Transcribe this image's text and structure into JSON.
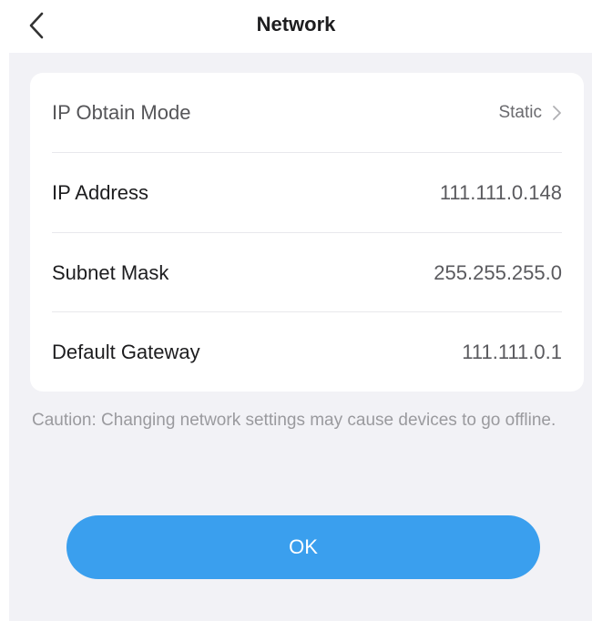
{
  "header": {
    "title": "Network",
    "back_icon": "chevron-left-icon"
  },
  "settings": {
    "rows": [
      {
        "label": "IP Obtain Mode",
        "value": "Static"
      },
      {
        "label": "IP Address",
        "value": "111.111.0.148"
      },
      {
        "label": "Subnet Mask",
        "value": "255.255.255.0"
      },
      {
        "label": "Default Gateway",
        "value": "111.111.0.1"
      }
    ],
    "chevron_icon": "chevron-right-icon"
  },
  "caution": "Caution: Changing network settings may cause devices to go offline.",
  "ok_button": {
    "label": "OK"
  },
  "colors": {
    "accent": "#3a9fee",
    "background": "#f2f2f6",
    "card": "#ffffff"
  }
}
